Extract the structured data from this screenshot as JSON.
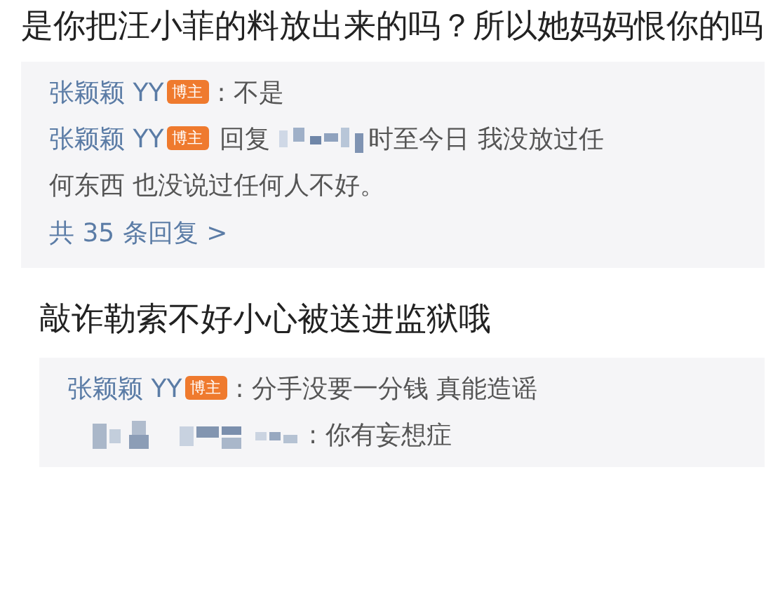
{
  "comments": [
    {
      "text": "是你把汪小菲的料放出来的吗？所以她妈妈恨你的吗",
      "replies": [
        {
          "kind": "author",
          "author": "张颖颖 YY",
          "badge": "博主",
          "text": ": 不是"
        },
        {
          "kind": "author_reply",
          "author": "张颖颖 YY",
          "badge": "博主",
          "prefix": "回复",
          "text_lines": [
            "时至今日 我没放过任",
            "何东西 也没说过任何人不好。"
          ]
        }
      ],
      "more": "共 35 条回复 >"
    },
    {
      "text": "敲诈勒索不好小心被送进监狱哦",
      "replies": [
        {
          "kind": "author",
          "author": "张颖颖 YY",
          "badge": "博主",
          "text": ": 分手没要一分钱 真能造谣"
        },
        {
          "kind": "hidden_user",
          "text": ": 你有妄想症"
        }
      ]
    }
  ]
}
